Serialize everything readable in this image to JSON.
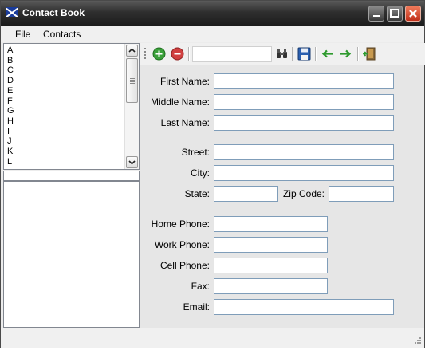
{
  "window": {
    "title": "Contact Book",
    "icon": "scotland-flag-icon"
  },
  "menu": {
    "file": "File",
    "contacts": "Contacts"
  },
  "letters": [
    "A",
    "B",
    "C",
    "D",
    "E",
    "F",
    "G",
    "H",
    "I",
    "J",
    "K",
    "L"
  ],
  "toolbar": {
    "add_icon": "add-contact-icon",
    "remove_icon": "remove-contact-icon",
    "search_value": "",
    "find_icon": "binoculars-icon",
    "save_icon": "floppy-disk-icon",
    "prev_icon": "arrow-left-icon",
    "next_icon": "arrow-right-icon",
    "exit_icon": "exit-door-icon"
  },
  "form": {
    "first_name": "First Name:",
    "middle_name": "Middle Name:",
    "last_name": "Last Name:",
    "street": "Street:",
    "city": "City:",
    "state": "State:",
    "zip": "Zip Code:",
    "home_phone": "Home Phone:",
    "work_phone": "Work Phone:",
    "cell_phone": "Cell Phone:",
    "fax": "Fax:",
    "email": "Email:"
  },
  "colors": {
    "add": "#3aa03a",
    "remove": "#d04040",
    "arrows": "#2e9a2e",
    "save": "#2a5fb0",
    "titlebar": "#2f2f2f"
  }
}
